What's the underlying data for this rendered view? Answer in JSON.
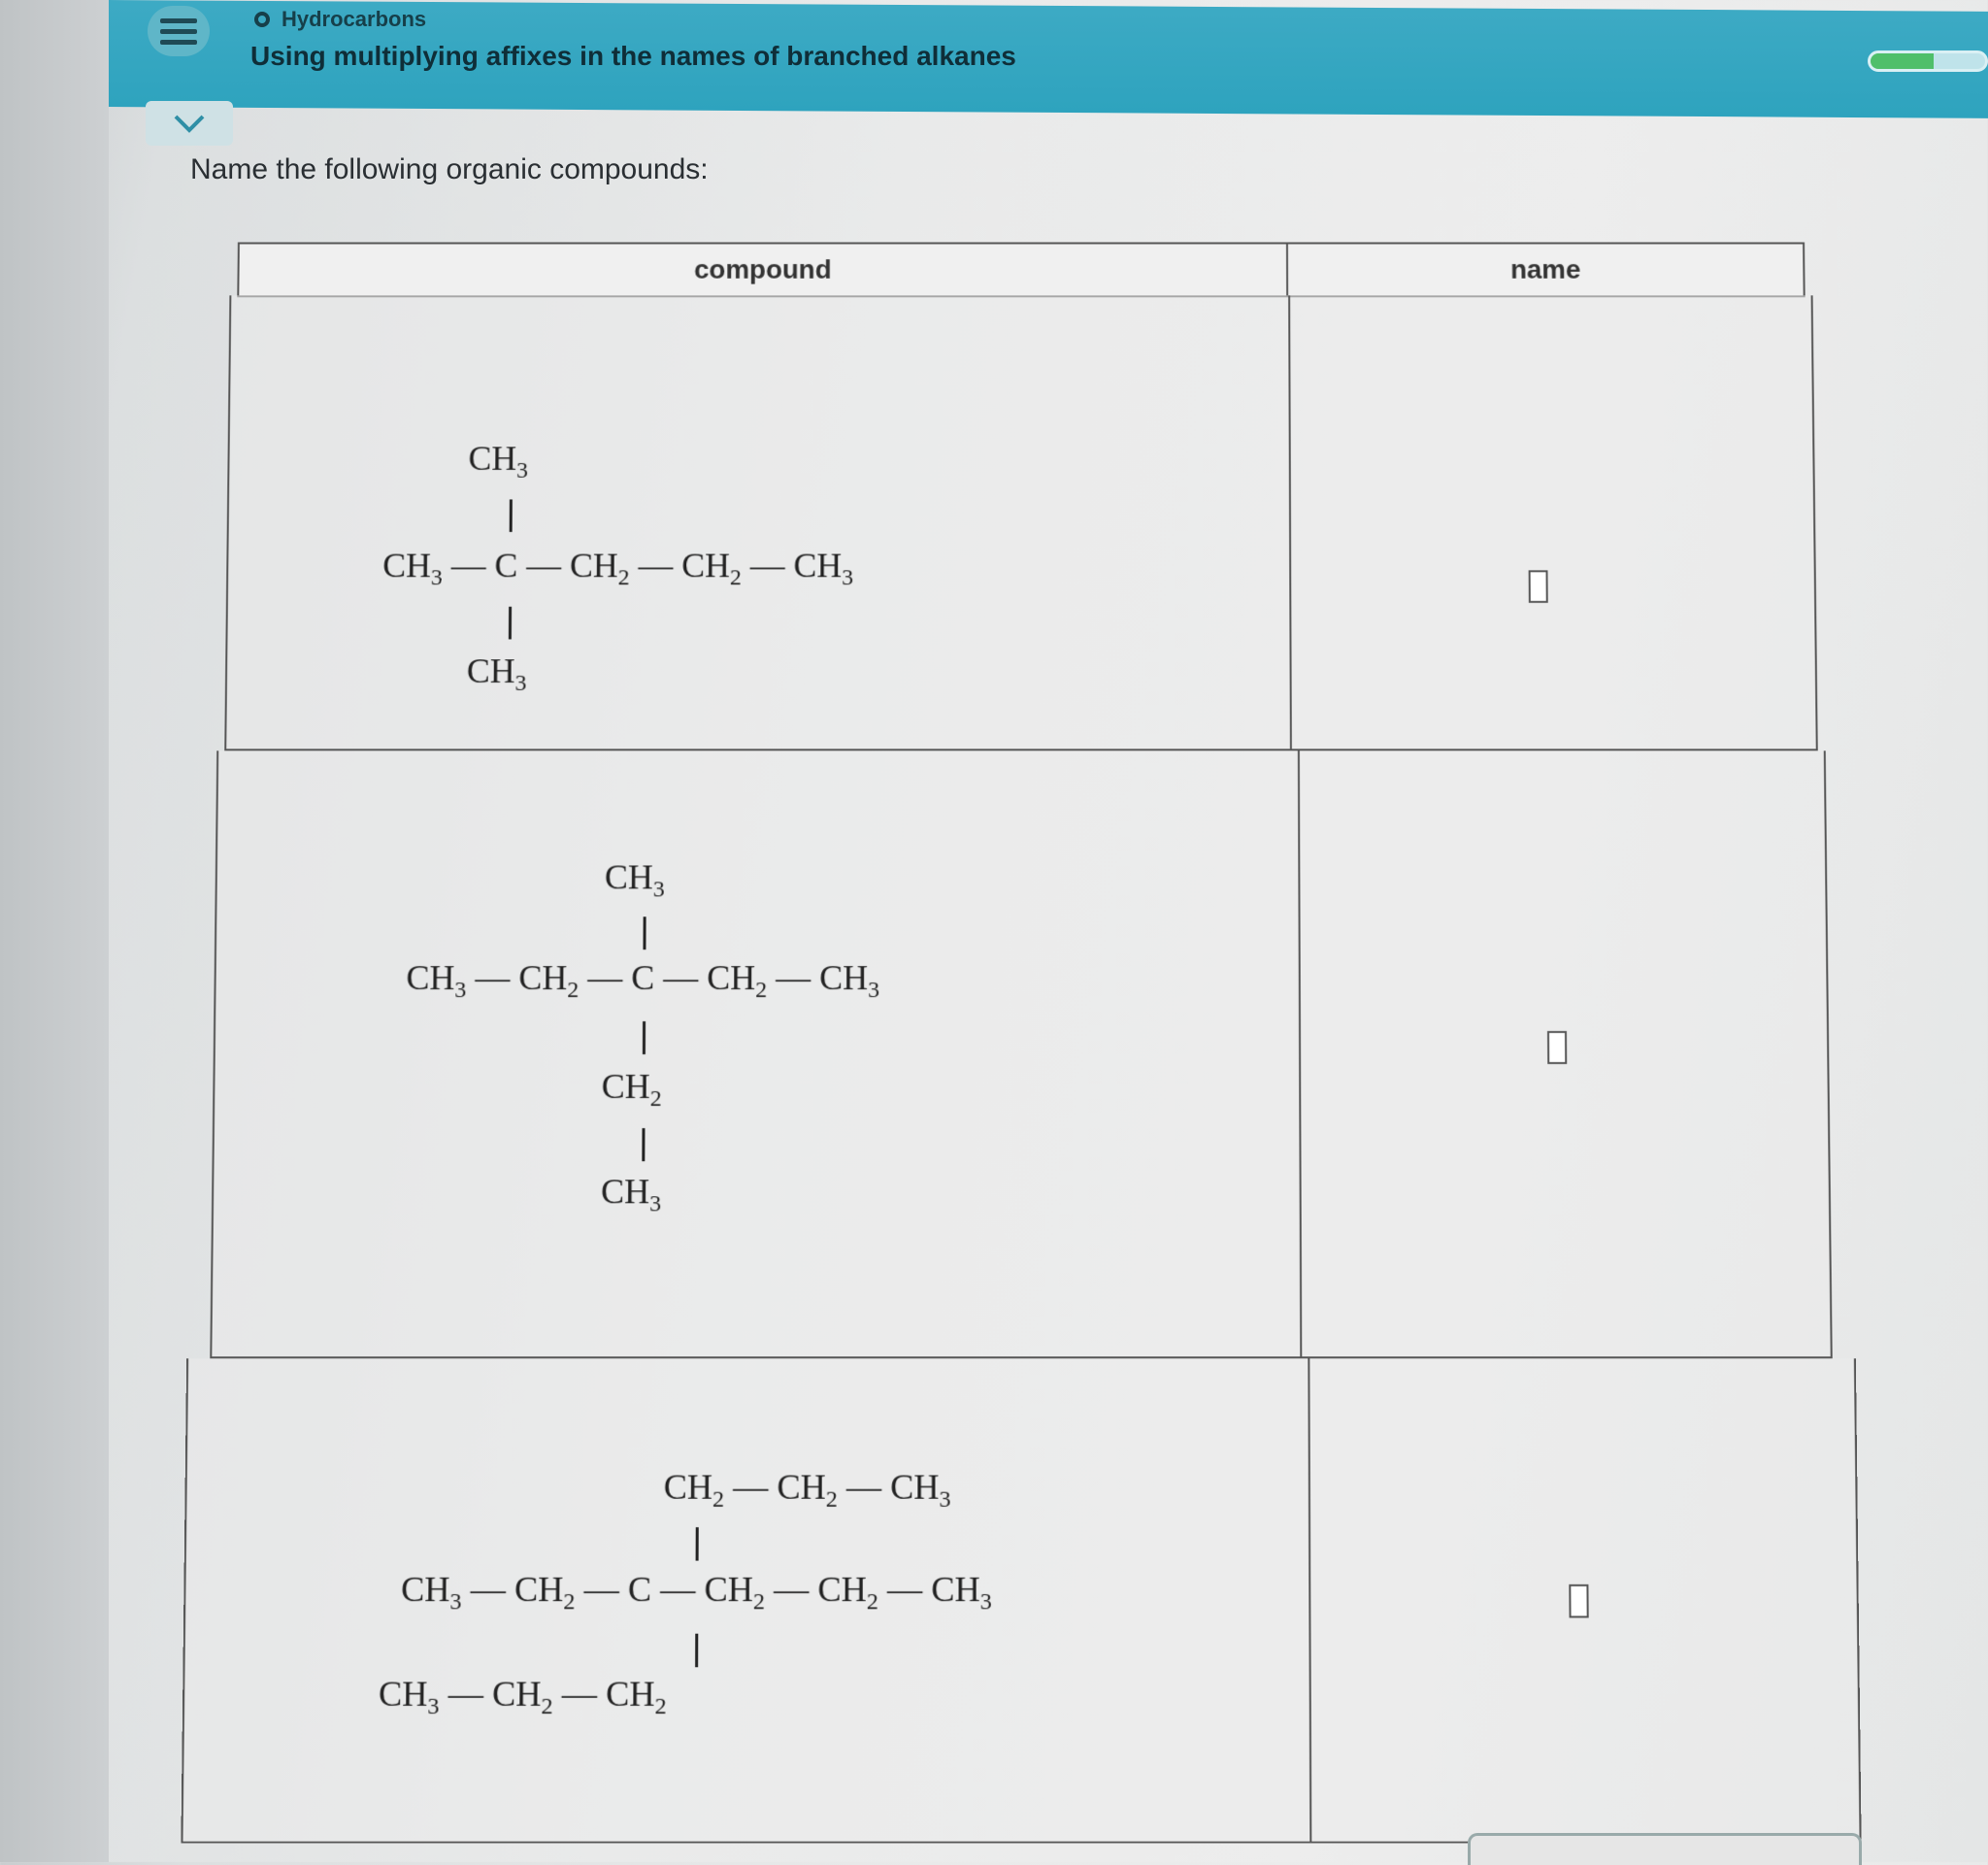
{
  "header": {
    "topic": "Hydrocarbons",
    "title": "Using multiplying affixes in the names of branched alkanes",
    "progress_fraction": 0.55
  },
  "prompt": "Name the following organic compounds:",
  "table": {
    "columns": [
      "compound",
      "name"
    ],
    "rows": [
      {
        "main_chain": [
          "CH3",
          "C",
          "CH2",
          "CH2",
          "CH3"
        ],
        "above": [
          "CH3"
        ],
        "below": [
          "CH3"
        ],
        "name_value": ""
      },
      {
        "main_chain": [
          "CH3",
          "CH2",
          "C",
          "CH2",
          "CH3"
        ],
        "above": [
          "CH3"
        ],
        "below": [
          "CH2",
          "CH3"
        ],
        "name_value": ""
      },
      {
        "main_chain": [
          "CH3",
          "CH2",
          "C",
          "CH2",
          "CH2",
          "CH3"
        ],
        "above": [
          "CH2",
          "CH2",
          "CH3"
        ],
        "below": [
          "CH3",
          "CH2",
          "CH2"
        ],
        "name_value": ""
      }
    ]
  }
}
